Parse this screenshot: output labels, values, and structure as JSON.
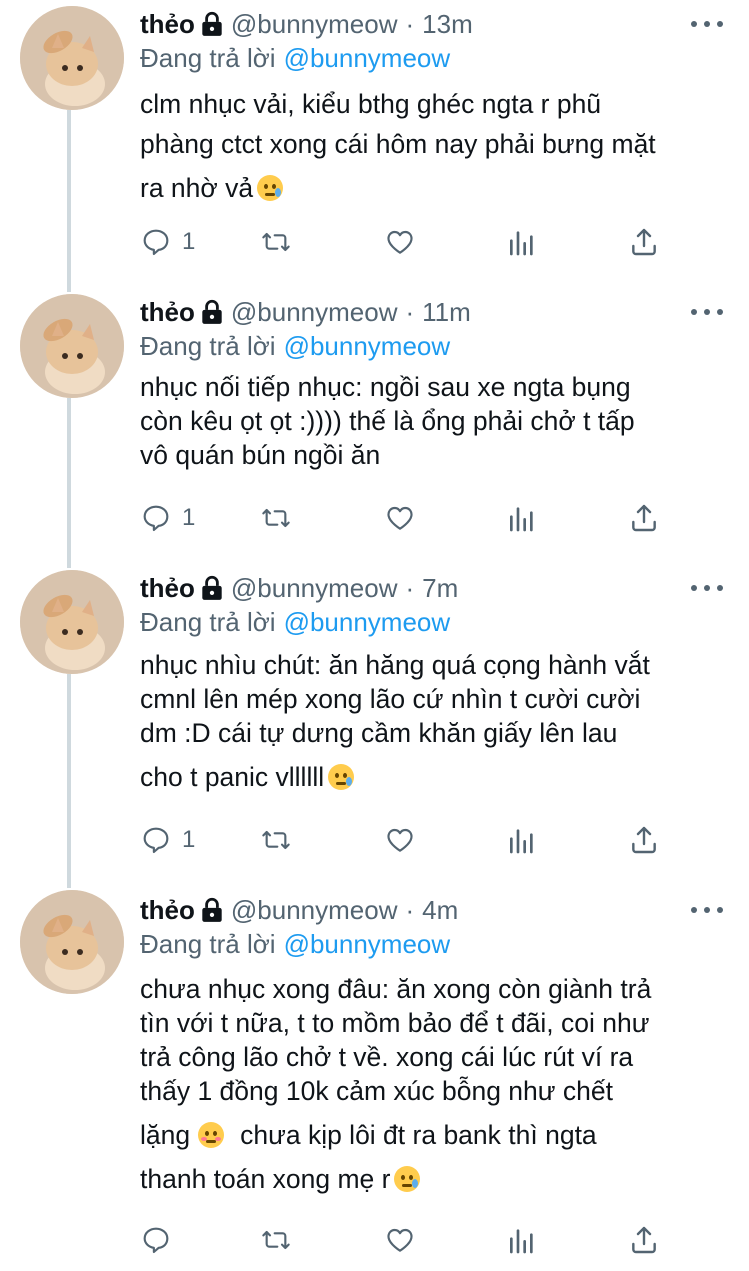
{
  "colors": {
    "primary_text": "#0f1419",
    "secondary_text": "#536471",
    "mention": "#1d9bf0",
    "thread_line": "#cfd9de"
  },
  "tweets": [
    {
      "name": "thẻo",
      "handle": "@bunnymeow",
      "separator": "·",
      "time": "13m",
      "replying_label": "Đang trả lời",
      "replying_to": "@bunnymeow",
      "lines": [
        "clm nhục vải, kiểu bthg ghéc ngta r phũ",
        "phàng ctct xong cái hôm nay phải bưng mặt",
        "ra nhờ vả"
      ],
      "emoji": "crying-smile",
      "reply_count": "1"
    },
    {
      "name": "thẻo",
      "handle": "@bunnymeow",
      "separator": "·",
      "time": "11m",
      "replying_label": "Đang trả lời",
      "replying_to": "@bunnymeow",
      "lines": [
        "nhục nối tiếp nhục: ngồi sau xe ngta bụng",
        "còn kêu ọt ọt :)))) thế là ổng phải chở t tấp",
        "vô quán bún ngồi ăn"
      ],
      "reply_count": "1"
    },
    {
      "name": "thẻo",
      "handle": "@bunnymeow",
      "separator": "·",
      "time": "7m",
      "replying_label": "Đang trả lời",
      "replying_to": "@bunnymeow",
      "lines": [
        "nhục nhìu chút: ăn hăng quá cọng hành vắt",
        "cmnl lên mép xong lão cứ nhìn t cười cười",
        "dm :D cái tự dưng cầm khăn giấy lên lau",
        "cho t panic vllllll"
      ],
      "emoji": "crying-smile",
      "reply_count": "1"
    },
    {
      "name": "thẻo",
      "handle": "@bunnymeow",
      "separator": "·",
      "time": "4m",
      "replying_label": "Đang trả lời",
      "replying_to": "@bunnymeow",
      "lines": [
        "chưa nhục xong đâu: ăn xong còn giành trả",
        "tìn với t nữa, t to mồm bảo để t đãi, coi như",
        "trả công lão chở t về. xong cái lúc rút ví ra",
        "thấy 1 đồng 10k cảm xúc bỗng như chết",
        "lặng",
        "chưa kịp lôi đt ra bank thì ngta",
        "thanh toán xong mẹ r"
      ],
      "reply_count": ""
    }
  ]
}
